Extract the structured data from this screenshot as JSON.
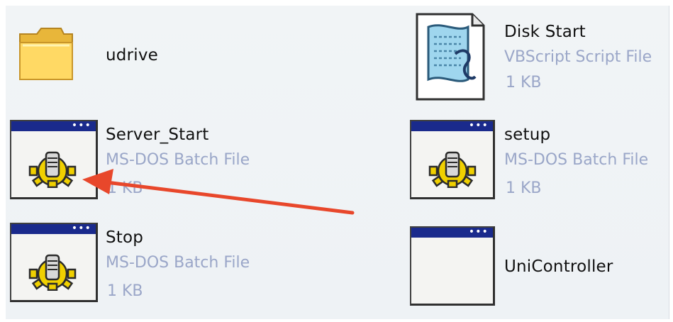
{
  "items": [
    {
      "name": "udrive",
      "type": "",
      "size": "",
      "icon": "folder-icon"
    },
    {
      "name": "Server_Start",
      "type": "MS-DOS Batch File",
      "size": "1 KB",
      "icon": "batch-file-icon"
    },
    {
      "name": "Stop",
      "type": "MS-DOS Batch File",
      "size": "1 KB",
      "icon": "batch-file-icon"
    },
    {
      "name": "Disk Start",
      "type": "VBScript Script File",
      "size": "1 KB",
      "icon": "vbscript-file-icon"
    },
    {
      "name": "setup",
      "type": "MS-DOS Batch File",
      "size": "1 KB",
      "icon": "batch-file-icon"
    },
    {
      "name": "UniController",
      "type": "",
      "size": "",
      "icon": "application-window-icon"
    }
  ],
  "annotation": {
    "icon": "red-arrow-icon",
    "color": "#e8472b",
    "points_to": "Server_Start"
  },
  "colors": {
    "window_titlebar": "#1a2a8c",
    "meta_text": "#9aa6c8",
    "gear": "#f0d000"
  }
}
